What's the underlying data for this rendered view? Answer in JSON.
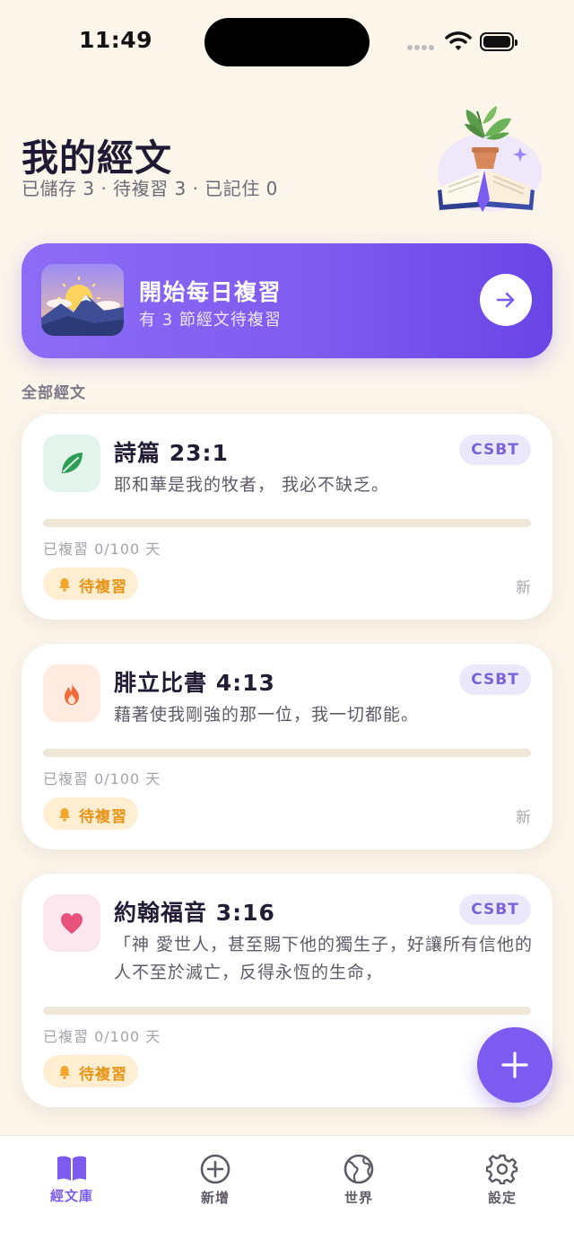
{
  "status_bar": {
    "time": "11:49"
  },
  "header": {
    "title": "我的經文",
    "subtitle": "已儲存 3 · 待複習 3 · 已記住 0"
  },
  "daily_review": {
    "title": "開始每日複習",
    "subtitle": "有 3 節經文待複習"
  },
  "section_label": "全部經文",
  "verses": [
    {
      "reference": "詩篇 23:1",
      "text": "耶和華是我的牧者， 我必不缺乏。",
      "translation": "CSBT",
      "icon": "leaf-icon",
      "icon_bg": "#E3F5EA",
      "progress_label": "已複習 0/100 天",
      "progress": 0,
      "status": "待複習",
      "tag": "新"
    },
    {
      "reference": "腓立比書 4:13",
      "text": "藉著使我剛強的那一位，我一切都能。",
      "translation": "CSBT",
      "icon": "flame-icon",
      "icon_bg": "#FFEBDF",
      "progress_label": "已複習 0/100 天",
      "progress": 0,
      "status": "待複習",
      "tag": "新"
    },
    {
      "reference": "約翰福音 3:16",
      "text": "「神 愛世人，甚至賜下他的獨生子，好讓所有信他的人不至於滅亡，反得永恆的生命，",
      "translation": "CSBT",
      "icon": "heart-icon",
      "icon_bg": "#FDE7EE",
      "progress_label": "已複習 0/100 天",
      "progress": 0,
      "status": "待複習"
    }
  ],
  "tabs": [
    {
      "label": "經文庫",
      "icon": "open-book-icon",
      "active": true
    },
    {
      "label": "新增",
      "icon": "plus-circle-icon",
      "active": false
    },
    {
      "label": "世界",
      "icon": "globe-icon",
      "active": false
    },
    {
      "label": "設定",
      "icon": "gear-icon",
      "active": false
    }
  ],
  "colors": {
    "accent": "#7B5BF0",
    "background": "#FBF5EA",
    "due": "#E69518",
    "inactive_tab": "#5F5A66"
  }
}
